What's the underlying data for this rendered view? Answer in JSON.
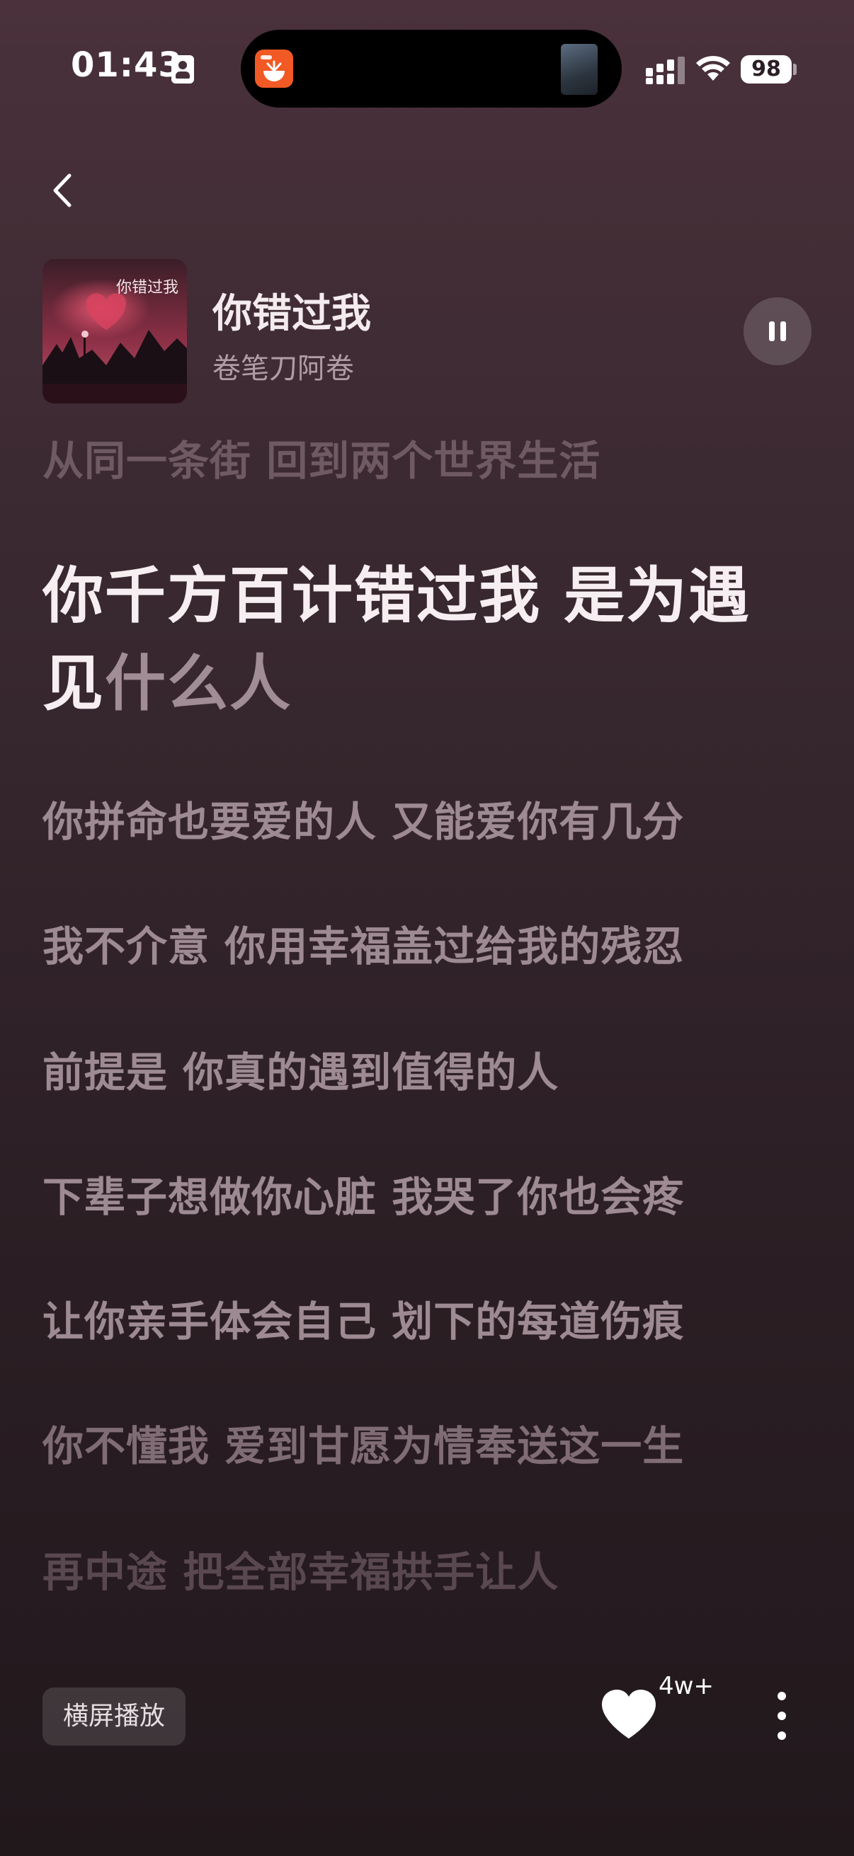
{
  "status_bar": {
    "time": "01:43",
    "battery": "98"
  },
  "song": {
    "title": "你错过我",
    "artist": "卷笔刀阿卷",
    "cover_text": "你错过我"
  },
  "lyrics": {
    "previous": "从同一条街 回到两个世界生活",
    "current_sung": "你千方百计错过我 是为遇见",
    "current_unsung": "什么人",
    "upcoming": [
      "你拼命也要爱的人 又能爱你有几分",
      "我不介意 你用幸福盖过给我的残忍",
      "前提是 你真的遇到值得的人",
      "下辈子想做你心脏 我哭了你也会疼",
      "让你亲手体会自己 划下的每道伤痕",
      "你不懂我 爱到甘愿为情奉送这一生",
      "再中途 把全部幸福拱手让人"
    ]
  },
  "bottom": {
    "landscape_label": "横屏播放",
    "like_count": "4w+"
  }
}
